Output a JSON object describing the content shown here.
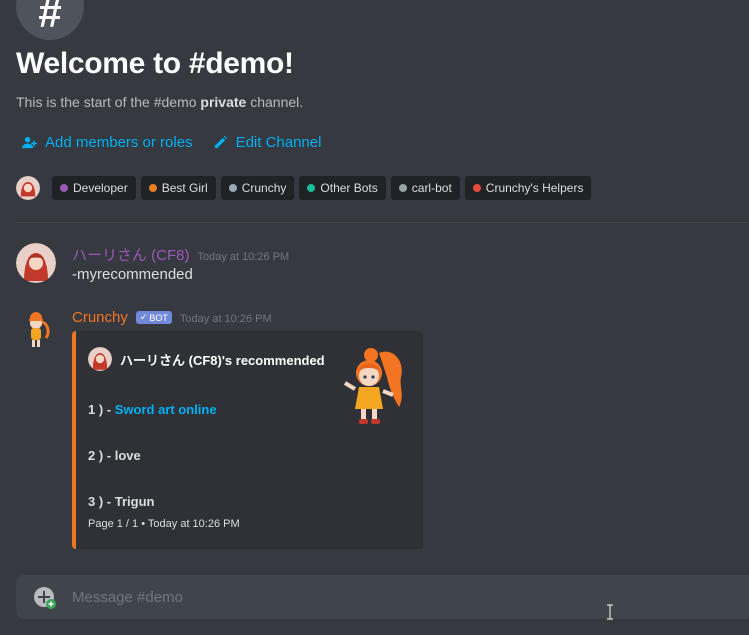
{
  "channel": {
    "icon": "hash-icon",
    "welcome_title": "Welcome to #demo!",
    "sub_prefix": "This is the start of the #demo ",
    "sub_bold": "private",
    "sub_suffix": " channel."
  },
  "actions": {
    "add_members": "Add members or roles",
    "edit_channel": "Edit Channel"
  },
  "roles": [
    {
      "label": "Developer",
      "color": "#9b59b6"
    },
    {
      "label": "Best Girl",
      "color": "#e67e22"
    },
    {
      "label": "Crunchy",
      "color": "#99aab5"
    },
    {
      "label": "Other Bots",
      "color": "#1abc9c"
    },
    {
      "label": "carl-bot",
      "color": "#95a5a6"
    },
    {
      "label": "Crunchy's Helpers",
      "color": "#e74c3c"
    }
  ],
  "messages": [
    {
      "author": "ハーリさん (CF8)",
      "author_color": "#9b59b6",
      "timestamp": "Today at 10:26 PM",
      "content": "-myrecommended"
    },
    {
      "author": "Crunchy",
      "author_color": "#f47521",
      "bot_tag": "BOT",
      "timestamp": "Today at 10:26 PM"
    }
  ],
  "embed": {
    "accent": "#f47521",
    "author": "ハーリさん (CF8)'s recommended",
    "lines": [
      {
        "prefix": "1 ) - ",
        "text": "Sword art online"
      },
      {
        "prefix": "2 ) - ",
        "text": "love"
      },
      {
        "prefix": "3 ) - ",
        "text": "Trigun"
      }
    ],
    "footer": "Page 1 / 1 • Today at 10:26 PM"
  },
  "composer": {
    "placeholder": "Message #demo"
  }
}
